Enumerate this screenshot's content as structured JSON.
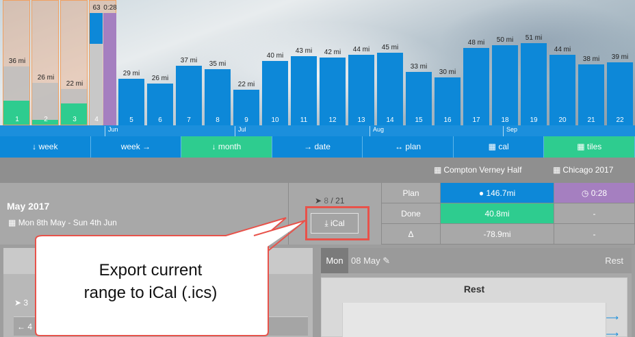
{
  "chart": {
    "past_weeks": [
      {
        "num": "1",
        "label": "36 mi",
        "planned": 36,
        "done": 15
      },
      {
        "num": "2",
        "label": "26 mi",
        "planned": 26,
        "done": 3
      },
      {
        "num": "3",
        "label": "22 mi",
        "planned": 22,
        "done": 13
      }
    ],
    "current_week": {
      "num": "4",
      "dist_label": "63",
      "time_label": "0:28"
    },
    "future_weeks": [
      {
        "num": "5",
        "label": "29 mi",
        "value": 29
      },
      {
        "num": "6",
        "label": "26 mi",
        "value": 26
      },
      {
        "num": "7",
        "label": "37 mi",
        "value": 37
      },
      {
        "num": "8",
        "label": "35 mi",
        "value": 35
      },
      {
        "num": "9",
        "label": "22 mi",
        "value": 22
      },
      {
        "num": "10",
        "label": "40 mi",
        "value": 40
      },
      {
        "num": "11",
        "label": "43 mi",
        "value": 43
      },
      {
        "num": "12",
        "label": "42 mi",
        "value": 42
      },
      {
        "num": "13",
        "label": "44 mi",
        "value": 44
      },
      {
        "num": "14",
        "label": "45 mi",
        "value": 45
      },
      {
        "num": "15",
        "label": "33 mi",
        "value": 33
      },
      {
        "num": "16",
        "label": "30 mi",
        "value": 30
      },
      {
        "num": "17",
        "label": "48 mi",
        "value": 48
      },
      {
        "num": "18",
        "label": "50 mi",
        "value": 50
      },
      {
        "num": "19",
        "label": "51 mi",
        "value": 51
      },
      {
        "num": "20",
        "label": "44 mi",
        "value": 44
      },
      {
        "num": "21",
        "label": "38 mi",
        "value": 38
      },
      {
        "num": "22",
        "label": "39 mi",
        "value": 39
      }
    ],
    "months": [
      "Jun",
      "Jul",
      "Aug",
      "Sep"
    ]
  },
  "nav": {
    "week_back": "↓ week",
    "week_fwd": "week →",
    "month": "↓ month",
    "date": "→ date",
    "plan": "↔ plan",
    "cal": "cal",
    "tiles": "tiles"
  },
  "races": [
    "Compton Verney Half",
    "Chicago 2017"
  ],
  "summary": {
    "title": "May 2017",
    "dates": "Mon 8th May - Sun 4th Jun",
    "sessions_done": "8",
    "sessions_total": "21",
    "ical_label": "iCal",
    "rows": [
      {
        "label": "Plan",
        "dist": "146.7mi",
        "time": "0:28"
      },
      {
        "label": "Done",
        "dist": "40.8mi",
        "time": "-"
      },
      {
        "label": "Δ",
        "dist": "-78.9mi",
        "time": "-"
      }
    ]
  },
  "day": {
    "name": "Mon",
    "date": "08 May",
    "rest_short": "Rest",
    "rest_title": "Rest"
  },
  "left": {
    "runs": "3",
    "back": "4"
  },
  "callout": {
    "line1": "Export current",
    "line2": "range to iCal (.ics)"
  },
  "colors": {
    "blue": "#0d88d8",
    "green": "#2ecc8f",
    "purple": "#a57fc0",
    "highlight": "#e8524a"
  }
}
